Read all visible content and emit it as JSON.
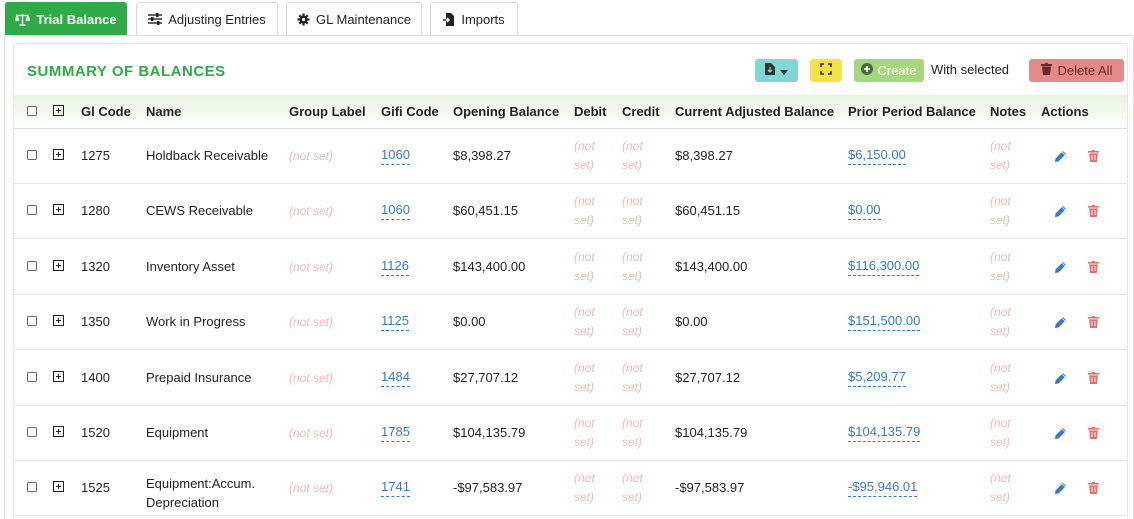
{
  "tabs": [
    {
      "label": "Trial Balance",
      "icon": "balance-scale-icon",
      "active": true
    },
    {
      "label": "Adjusting Entries",
      "icon": "sliders-icon",
      "active": false
    },
    {
      "label": "GL Maintenance",
      "icon": "gear-icon",
      "active": false
    },
    {
      "label": "Imports",
      "icon": "file-import-icon",
      "active": false
    }
  ],
  "panel": {
    "title": "SUMMARY OF BALANCES",
    "create_label": "Create",
    "with_selected_label": "With selected",
    "delete_all_label": "Delete All"
  },
  "colors": {
    "accent": "#2faa46",
    "link": "#3a78c2",
    "not_set": "#f0b9b9",
    "delete": "#e58a8a",
    "export": "#7fd6d4",
    "expand": "#f5e14a",
    "create": "#a6d67e"
  },
  "table": {
    "columns": [
      "Gl Code",
      "Name",
      "Group Label",
      "Gifi Code",
      "Opening Balance",
      "Debit",
      "Credit",
      "Current Adjusted Balance",
      "Prior Period Balance",
      "Notes",
      "Actions"
    ],
    "not_set_text": "(not set)",
    "not_set_line1": "(not",
    "not_set_line2": "set)",
    "rows": [
      {
        "gl_code": "1275",
        "name_line1": "Holdback Receivable",
        "name_line2": "",
        "group_label": "(not set)",
        "gifi_code": "1060",
        "opening_balance": "$8,398.27",
        "debit": "(not set)",
        "credit": "(not set)",
        "current_adjusted_balance": "$8,398.27",
        "prior_period_balance": "$6,150.00",
        "notes": "(not set)"
      },
      {
        "gl_code": "1280",
        "name_line1": "CEWS Receivable",
        "name_line2": "",
        "group_label": "(not set)",
        "gifi_code": "1060",
        "opening_balance": "$60,451.15",
        "debit": "(not set)",
        "credit": "(not set)",
        "current_adjusted_balance": "$60,451.15",
        "prior_period_balance": "$0.00",
        "notes": "(not set)"
      },
      {
        "gl_code": "1320",
        "name_line1": "Inventory Asset",
        "name_line2": "",
        "group_label": "(not set)",
        "gifi_code": "1126",
        "opening_balance": "$143,400.00",
        "debit": "(not set)",
        "credit": "(not set)",
        "current_adjusted_balance": "$143,400.00",
        "prior_period_balance": "$116,300.00",
        "notes": "(not set)"
      },
      {
        "gl_code": "1350",
        "name_line1": "Work in Progress",
        "name_line2": "",
        "group_label": "(not set)",
        "gifi_code": "1125",
        "opening_balance": "$0.00",
        "debit": "(not set)",
        "credit": "(not set)",
        "current_adjusted_balance": "$0.00",
        "prior_period_balance": "$151,500.00",
        "notes": "(not set)"
      },
      {
        "gl_code": "1400",
        "name_line1": "Prepaid Insurance",
        "name_line2": "",
        "group_label": "(not set)",
        "gifi_code": "1484",
        "opening_balance": "$27,707.12",
        "debit": "(not set)",
        "credit": "(not set)",
        "current_adjusted_balance": "$27,707.12",
        "prior_period_balance": "$5,209.77",
        "notes": "(not set)"
      },
      {
        "gl_code": "1520",
        "name_line1": "Equipment",
        "name_line2": "",
        "group_label": "(not set)",
        "gifi_code": "1785",
        "opening_balance": "$104,135.79",
        "debit": "(not set)",
        "credit": "(not set)",
        "current_adjusted_balance": "$104,135.79",
        "prior_period_balance": "$104,135.79",
        "notes": "(not set)"
      },
      {
        "gl_code": "1525",
        "name_line1": "Equipment:Accum.",
        "name_line2": "Depreciation",
        "group_label": "(not set)",
        "gifi_code": "1741",
        "opening_balance": "-$97,583.97",
        "debit": "(not set)",
        "credit": "(not set)",
        "current_adjusted_balance": "-$97,583.97",
        "prior_period_balance": "-$95,946.01",
        "notes": "(not set)"
      }
    ]
  }
}
